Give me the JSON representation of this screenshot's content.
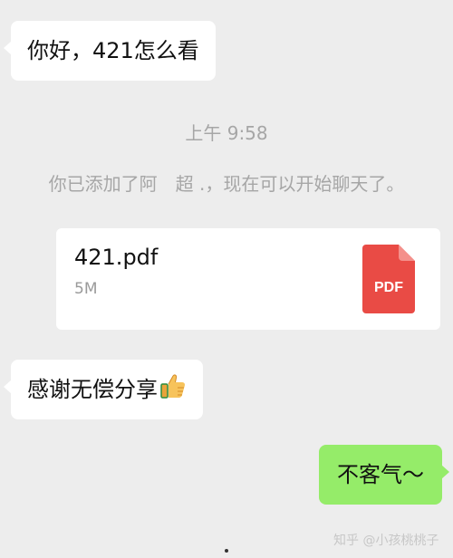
{
  "chat": {
    "message_1": {
      "text": "你好，421怎么看",
      "direction": "incoming"
    },
    "timestamp": "上午 9:58",
    "system_notice": "你已添加了阿　超 .，现在可以开始聊天了。",
    "file_message": {
      "file_name": "421.pdf",
      "file_size": "5M",
      "file_type_label": "PDF",
      "icon": "pdf-file-icon",
      "icon_color": "#e94b45"
    },
    "message_2": {
      "text": "感谢无偿分享",
      "emoji": "thumbs-up-icon",
      "direction": "incoming"
    },
    "message_3": {
      "text": "不客气～",
      "direction": "outgoing"
    }
  },
  "watermark": {
    "text": "知乎 @小孩桃桃子"
  },
  "colors": {
    "background": "#ededed",
    "incoming_bubble": "#ffffff",
    "outgoing_bubble": "#95ec69",
    "muted_text": "#a6a6a6"
  }
}
